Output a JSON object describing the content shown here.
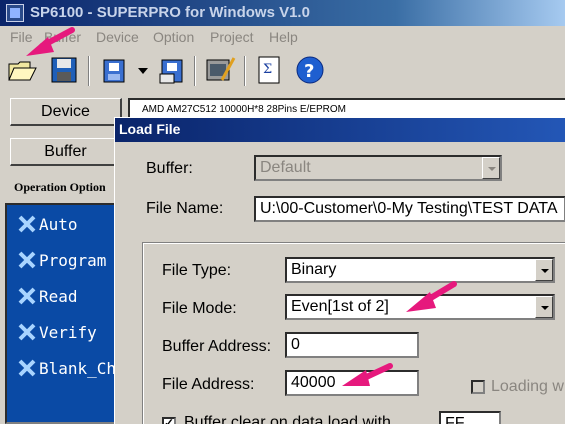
{
  "window": {
    "title": "SP6100 - SUPERPRO for Windows V1.0"
  },
  "menu": [
    "File",
    "Buffer",
    "Device",
    "Option",
    "Project",
    "Help"
  ],
  "toolbar": {
    "icons": [
      "open-file-icon",
      "save-icon",
      "load-project-icon",
      "save-project-icon",
      "auto-config-icon",
      "sum-icon",
      "help-icon"
    ]
  },
  "left": {
    "device_button": "Device",
    "buffer_button": "Buffer",
    "operation_label": "Operation Option",
    "operations": [
      "Auto",
      "Program",
      "Read",
      "Verify",
      "Blank_Ch"
    ]
  },
  "device_info": "AMD  AM27C512   10000H*8   28Pins   E/EPROM",
  "dialog": {
    "title": "Load File",
    "buffer_label": "Buffer:",
    "buffer_value": "Default",
    "filename_label": "File Name:",
    "filename_value": "U:\\00-Customer\\0-My Testing\\TEST DATA",
    "filetype_label": "File Type:",
    "filetype_value": "Binary",
    "filemode_label": "File Mode:",
    "filemode_value": "Even[1st of 2]",
    "bufaddr_label": "Buffer Address:",
    "bufaddr_value": "0",
    "fileaddr_label": "File Address:",
    "fileaddr_value": "40000",
    "loading_label": "Loading w",
    "bufferclear_label": "Buffer clear on data load with",
    "bufferclear_value": "FF"
  },
  "colors": {
    "annotation_arrow": "#e6197d",
    "op_panel": "#0a4aa5",
    "title_gradient_start": "#0a246a"
  }
}
